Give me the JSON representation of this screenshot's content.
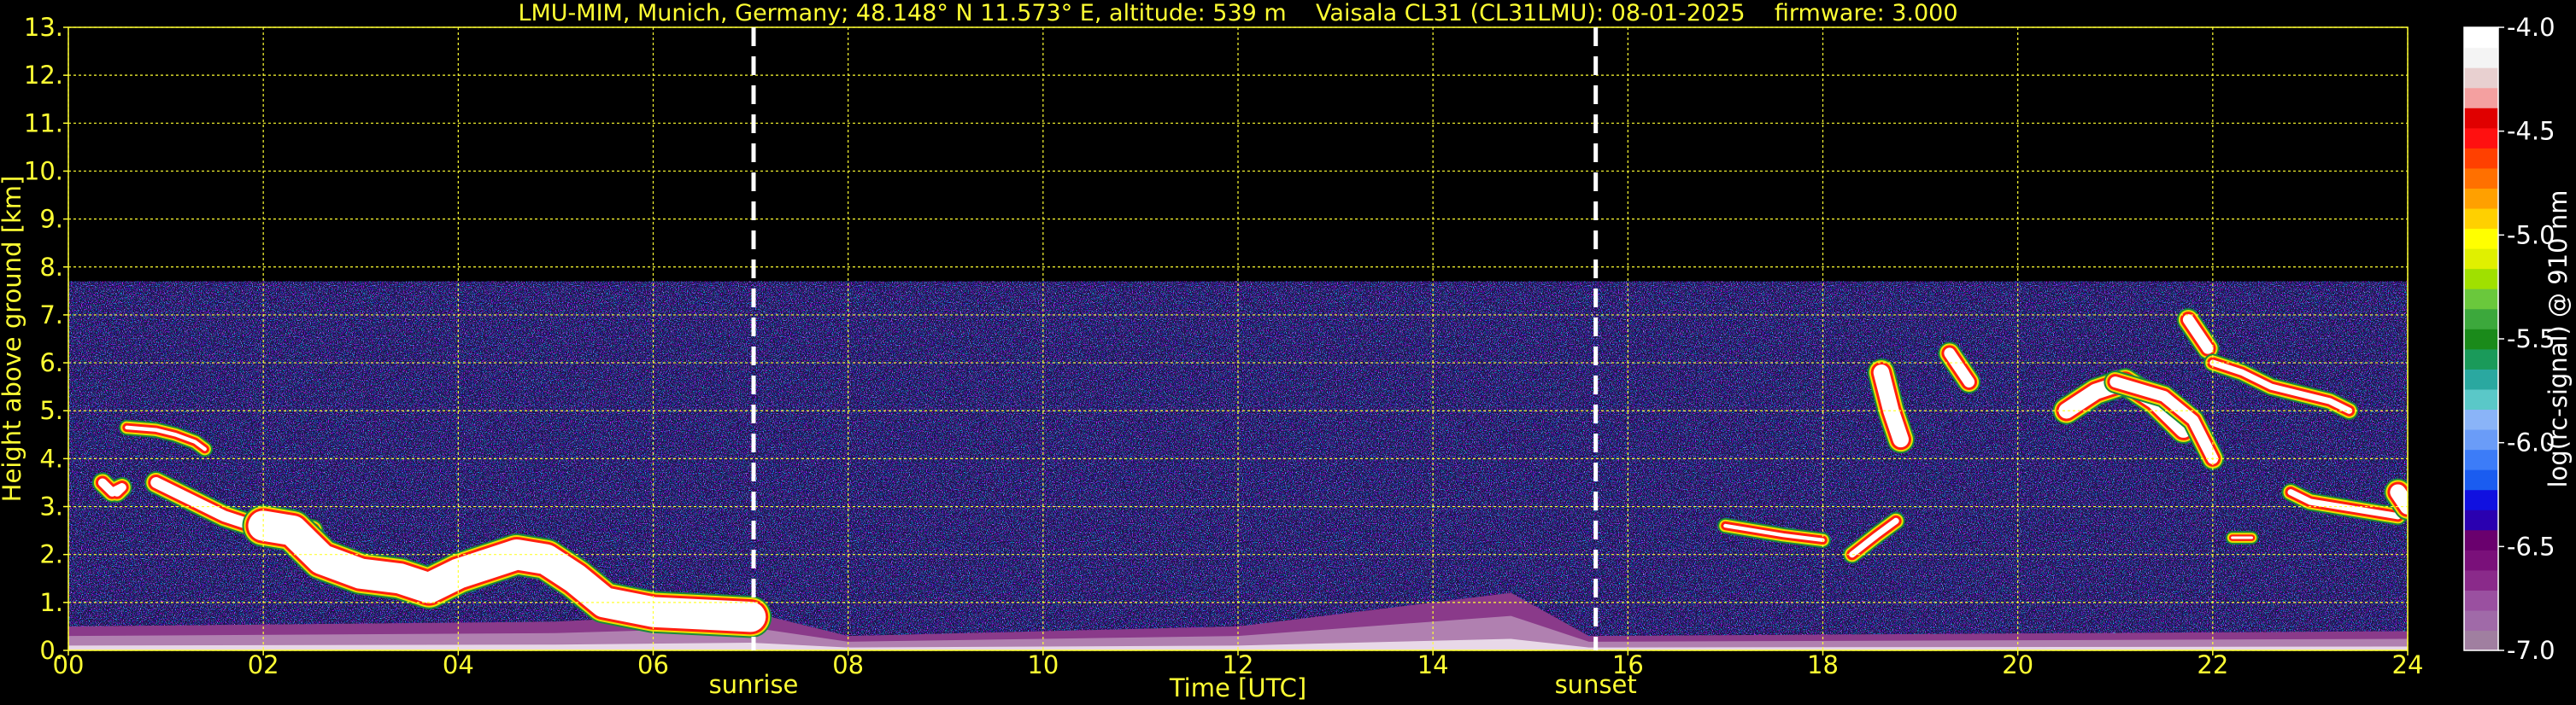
{
  "chart_data": {
    "type": "heatmap",
    "title": "LMU-MIM, Munich, Germany; 48.148° N 11.573° E, altitude: 539 m    Vaisala CL31 (CL31LMU): 08-01-2025    firmware: 3.000",
    "xlabel": "Time [UTC]",
    "ylabel": "Height above ground [km]",
    "xlim": [
      0,
      24
    ],
    "ylim": [
      0,
      13
    ],
    "x_ticks": [
      "00",
      "02",
      "04",
      "06",
      "08",
      "10",
      "12",
      "14",
      "16",
      "18",
      "20",
      "22",
      "24"
    ],
    "y_ticks": [
      "0.",
      "1.",
      "2.",
      "3.",
      "4.",
      "5.",
      "6.",
      "7.",
      "8.",
      "9.",
      "10.",
      "11.",
      "12.",
      "13."
    ],
    "grid": true,
    "colorbar": {
      "label": "log(rc-signal) @ 910 nm",
      "range": [
        -7.0,
        -4.0
      ],
      "ticks": [
        "-4.0",
        "-4.5",
        "-5.0",
        "-5.5",
        "-6.0",
        "-6.5",
        "-7.0"
      ],
      "colors": [
        "#a07fa0",
        "#a06aa8",
        "#9a50a0",
        "#8a2a8a",
        "#7a107a",
        "#6a006e",
        "#2a00b0",
        "#1010e0",
        "#1a5cf0",
        "#3c7cf8",
        "#6a9cf8",
        "#8ab4f8",
        "#5ac8c8",
        "#2aa8a0",
        "#1a9a5a",
        "#1a8a1a",
        "#3ca83c",
        "#6ac83c",
        "#a0e000",
        "#e0f000",
        "#ffff00",
        "#ffd000",
        "#ffa000",
        "#ff7000",
        "#ff4000",
        "#ff1010",
        "#e00000",
        "#f4a0a0",
        "#e8d0d0",
        "#f4f4f4",
        "#ffffff"
      ]
    },
    "events": [
      {
        "label": "sunrise",
        "time": 7.03
      },
      {
        "label": "sunset",
        "time": 15.67
      }
    ],
    "features": {
      "signal_top_km": 7.7,
      "boundary_layer": [
        {
          "t": 0.0,
          "top_km": 0.5
        },
        {
          "t": 5.0,
          "top_km": 0.6
        },
        {
          "t": 7.0,
          "top_km": 0.8
        },
        {
          "t": 8.0,
          "top_km": 0.3
        },
        {
          "t": 12.0,
          "top_km": 0.5
        },
        {
          "t": 14.8,
          "top_km": 1.2
        },
        {
          "t": 15.6,
          "top_km": 0.3
        },
        {
          "t": 24.0,
          "top_km": 0.4
        }
      ],
      "cloud_layers": [
        {
          "t": [
            0.35,
            0.45,
            0.55,
            0.5
          ],
          "km": [
            3.5,
            3.3,
            3.4,
            3.3
          ],
          "thickness_km": 0.25
        },
        {
          "t": [
            0.6,
            0.9,
            1.1,
            1.3,
            1.4
          ],
          "km": [
            4.65,
            4.6,
            4.5,
            4.35,
            4.2
          ],
          "thickness_km": 0.15
        },
        {
          "t": [
            0.9,
            1.3,
            1.6,
            1.9,
            2.2,
            2.5
          ],
          "km": [
            3.5,
            3.1,
            2.8,
            2.6,
            2.55,
            2.5
          ],
          "thickness_km": 0.3
        },
        {
          "t": [
            2.0,
            2.3,
            2.6,
            3.0,
            3.4,
            3.7,
            4.0,
            4.3,
            4.6,
            4.9,
            5.2,
            5.5,
            6.0,
            6.5,
            7.0
          ],
          "km": [
            2.6,
            2.5,
            1.9,
            1.6,
            1.5,
            1.3,
            1.6,
            1.8,
            2.0,
            1.9,
            1.5,
            1.0,
            0.8,
            0.75,
            0.7
          ],
          "thickness_km": 0.7
        },
        {
          "t": [
            17.0,
            17.3,
            17.6,
            18.0
          ],
          "km": [
            2.6,
            2.5,
            2.4,
            2.3
          ],
          "thickness_km": 0.15
        },
        {
          "t": [
            18.3,
            18.55,
            18.75
          ],
          "km": [
            2.0,
            2.4,
            2.7
          ],
          "thickness_km": 0.2
        },
        {
          "t": [
            18.6,
            18.7,
            18.8
          ],
          "km": [
            5.8,
            5.0,
            4.4
          ],
          "thickness_km": 0.4
        },
        {
          "t": [
            19.3,
            19.4,
            19.5
          ],
          "km": [
            6.2,
            5.9,
            5.6
          ],
          "thickness_km": 0.3
        },
        {
          "t": [
            20.5,
            20.8,
            21.1,
            21.4,
            21.7
          ],
          "km": [
            5.0,
            5.4,
            5.6,
            5.2,
            4.6
          ],
          "thickness_km": 0.4
        },
        {
          "t": [
            21.0,
            21.5,
            21.8,
            22.0
          ],
          "km": [
            5.6,
            5.3,
            4.8,
            4.0
          ],
          "thickness_km": 0.3
        },
        {
          "t": [
            21.75,
            21.85,
            21.95
          ],
          "km": [
            6.9,
            6.6,
            6.3
          ],
          "thickness_km": 0.3
        },
        {
          "t": [
            22.0,
            22.3,
            22.6,
            22.9,
            23.2,
            23.4
          ],
          "km": [
            6.0,
            5.8,
            5.5,
            5.35,
            5.2,
            5.0
          ],
          "thickness_km": 0.2
        },
        {
          "t": [
            22.2,
            22.4
          ],
          "km": [
            2.35,
            2.35
          ],
          "thickness_km": 0.1
        },
        {
          "t": [
            22.8,
            23.0,
            23.3,
            23.6,
            23.9
          ],
          "km": [
            3.3,
            3.1,
            3.0,
            2.9,
            2.8
          ],
          "thickness_km": 0.2
        },
        {
          "t": [
            23.9,
            24.0
          ],
          "km": [
            3.3,
            3.0
          ],
          "thickness_km": 0.4
        }
      ]
    }
  }
}
